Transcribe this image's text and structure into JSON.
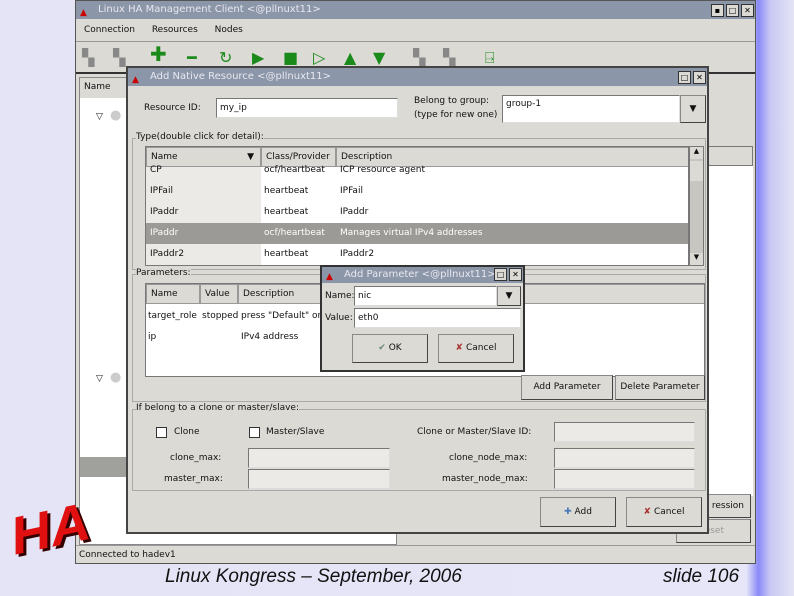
{
  "main_window": {
    "title": "Linux HA Management Client <@pllnuxt11>",
    "menu": [
      "Connection",
      "Resources",
      "Nodes"
    ],
    "toolbar": [
      "login-icon",
      "logout-icon",
      "add-icon",
      "remove-icon",
      "refresh-icon",
      "start-icon",
      "stop-icon",
      "play-outline-icon",
      "up-icon",
      "down-icon",
      "standby-icon",
      "active-icon",
      "exit-icon"
    ],
    "tree_header": "Name",
    "status": "Connected to hadev1",
    "right_buttons": [
      "ression",
      "eset"
    ]
  },
  "native_dialog": {
    "title": "Add Native Resource <@pllnuxt11>",
    "resource_id_label": "Resource ID:",
    "resource_id": "my_ip",
    "group_label_1": "Belong to group:",
    "group_label_2": "(type for new one)",
    "group": "group-1",
    "type_frame": "Type(double click for detail):",
    "type_columns": [
      "Name",
      "Class/Provider",
      "Description"
    ],
    "type_rows": [
      [
        "CP",
        "ocf/heartbeat",
        "ICP resource agent"
      ],
      [
        "IPFail",
        "heartbeat",
        "IPFail"
      ],
      [
        "IPaddr",
        "heartbeat",
        "IPaddr"
      ],
      [
        "IPaddr",
        "ocf/heartbeat",
        "Manages virtual IPv4 addresses"
      ],
      [
        "IPaddr2",
        "heartbeat",
        "IPaddr2"
      ]
    ],
    "selected_type_row": 3,
    "params_frame": "Parameters:",
    "param_columns": [
      "Name",
      "Value",
      "Description"
    ],
    "param_rows": [
      [
        "target_role",
        "stopped",
        "press \"Default\" or ... resource"
      ],
      [
        "ip",
        "",
        "IPv4 address"
      ]
    ],
    "add_param": "Add Parameter",
    "delete_param": "Delete Parameter",
    "clone_frame": "If belong to a clone or master/slave:",
    "clone": "Clone",
    "master_slave": "Master/Slave",
    "clone_id_label": "Clone or Master/Slave ID:",
    "clone_max": "clone_max:",
    "master_max": "master_max:",
    "clone_node_max": "clone_node_max:",
    "master_node_max": "master_node_max:",
    "add": "Add",
    "cancel": "Cancel"
  },
  "param_dialog": {
    "title": "Add Parameter <@pllnuxt11>",
    "name_label": "Name:",
    "name": "nic",
    "value_label": "Value:",
    "value": "eth0",
    "ok": "OK",
    "cancel": "Cancel"
  },
  "footer": {
    "event": "Linux Kongress – September, 2006",
    "slide": "slide 106",
    "logo": "HA"
  }
}
